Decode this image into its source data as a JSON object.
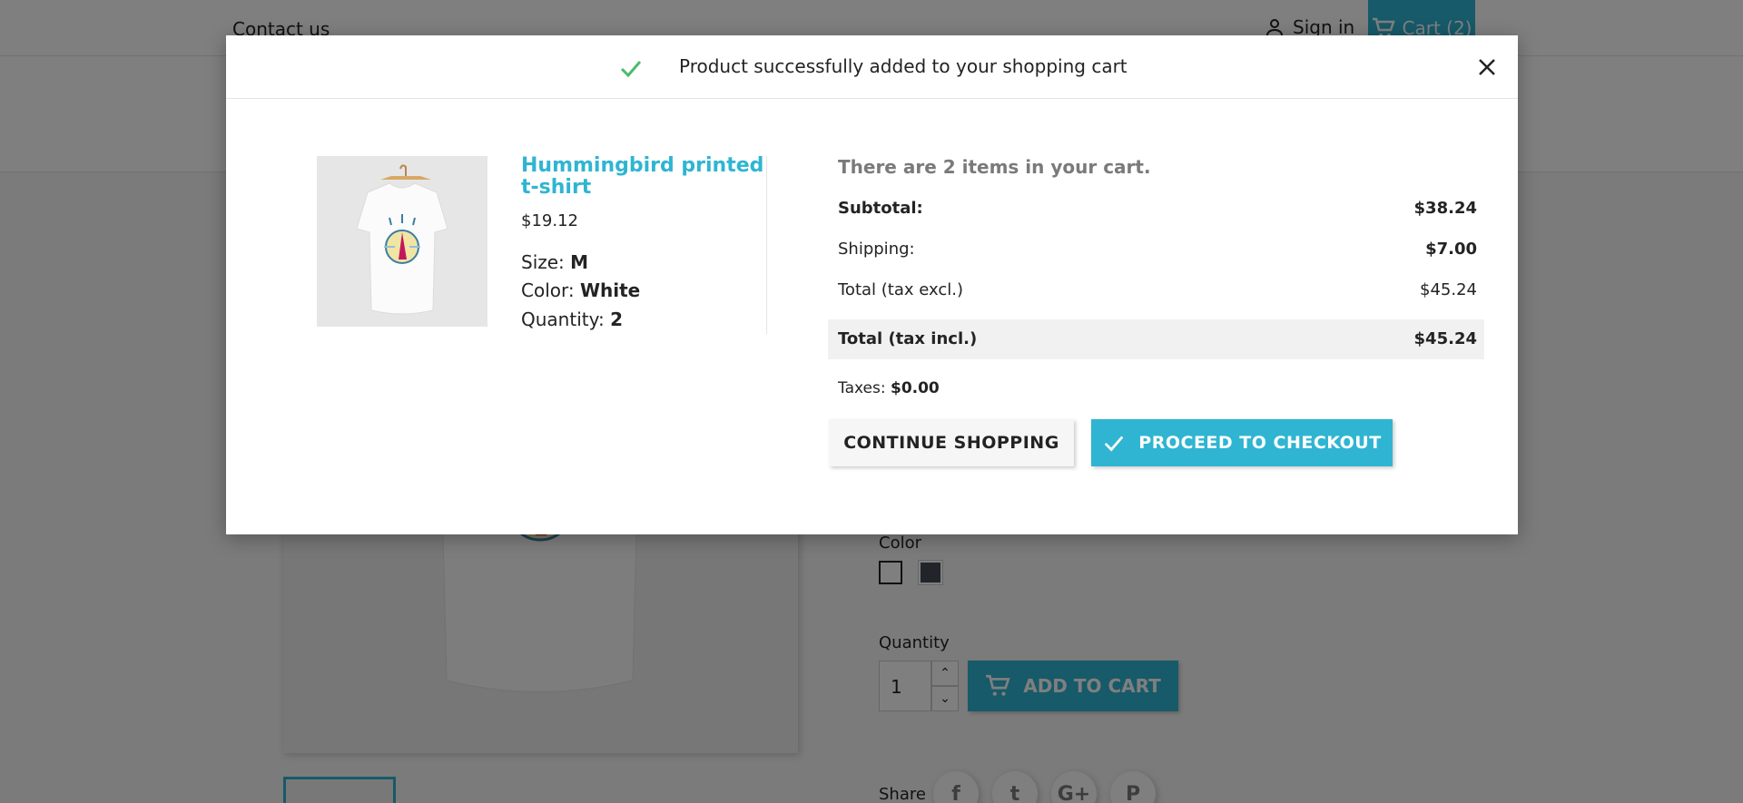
{
  "page": {
    "topbar": {
      "contact_label": "Contact us",
      "signin_label": "Sign in",
      "cart_label": "Cart (2)"
    },
    "product": {
      "color_label": "Color",
      "quantity_label": "Quantity",
      "quantity_value": "1",
      "add_to_cart_label": "ADD TO CART",
      "share_label": "Share",
      "share_icons": [
        "facebook-icon",
        "twitter-icon",
        "google-plus-icon",
        "pinterest-icon"
      ],
      "share_glyphs": [
        "f",
        "t",
        "G+",
        "P"
      ]
    }
  },
  "modal": {
    "header": {
      "title": "Product successfully added to your shopping cart",
      "accent": "#4cbb6c"
    },
    "product": {
      "name": "Hummingbird printed t-shirt",
      "price": "$19.12",
      "size_label": "Size:",
      "size_value": "M",
      "color_label": "Color:",
      "color_value": "White",
      "quantity_label": "Quantity:",
      "quantity_value": "2"
    },
    "cart": {
      "count_text": "There are 2 items in your cart.",
      "subtotal_label": "Subtotal:",
      "subtotal_value": "$38.24",
      "shipping_label": "Shipping:",
      "shipping_value": "$7.00",
      "total_excl_label": "Total (tax excl.)",
      "total_excl_value": "$45.24",
      "total_incl_label": "Total (tax incl.)",
      "total_incl_value": "$45.24",
      "taxes_label": "Taxes:",
      "taxes_value": "$0.00"
    },
    "buttons": {
      "continue_label": "CONTINUE SHOPPING",
      "checkout_label": "PROCEED TO CHECKOUT"
    }
  },
  "colors": {
    "brand": "#2fb5d2",
    "success": "#4cbb6c"
  }
}
